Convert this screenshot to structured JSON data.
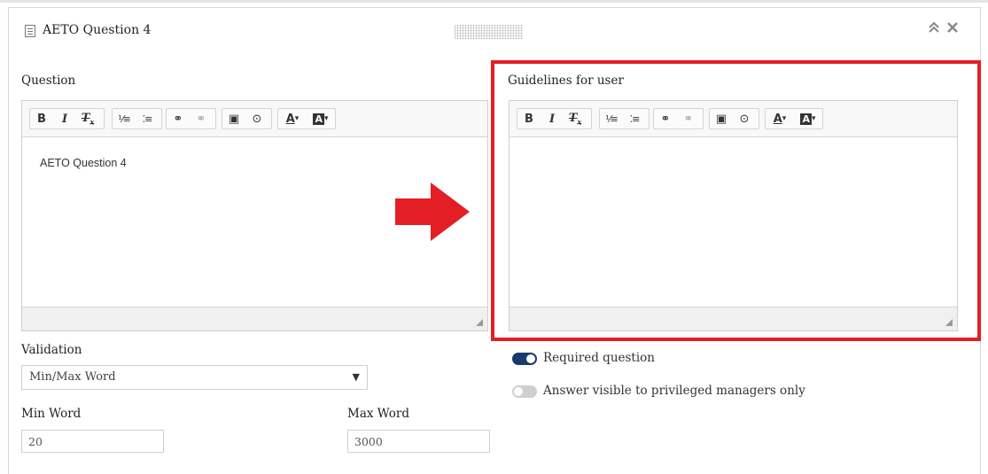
{
  "panel": {
    "title": "AETO Question 4",
    "collapse_glyph": "≪",
    "close_glyph": "✕",
    "icon": "document-icon"
  },
  "question": {
    "label": "Question",
    "content": "AETO Question 4"
  },
  "guidelines": {
    "label": "Guidelines for user",
    "content": ""
  },
  "toolbar": {
    "bold": "B",
    "italic": "I",
    "remove_format": "Tx",
    "numbered_list": "1≡",
    "bulleted_list": "•≡",
    "link": "∞",
    "unlink": "⊘",
    "image": "▣",
    "media": "▶",
    "text_color": "A▾",
    "bg_color": "A▾"
  },
  "validation": {
    "label": "Validation",
    "selected": "Min/Max Word"
  },
  "min_word": {
    "label": "Min Word",
    "value": "20"
  },
  "max_word": {
    "label": "Max Word",
    "value": "3000"
  },
  "toggles": {
    "required": {
      "label": "Required question",
      "on": true
    },
    "privileged": {
      "label": "Answer visible to privileged managers only",
      "on": false
    }
  },
  "colors": {
    "highlight": "#e31e24",
    "toggle_on": "#173b6b",
    "toggle_off": "#cfcfcf"
  }
}
